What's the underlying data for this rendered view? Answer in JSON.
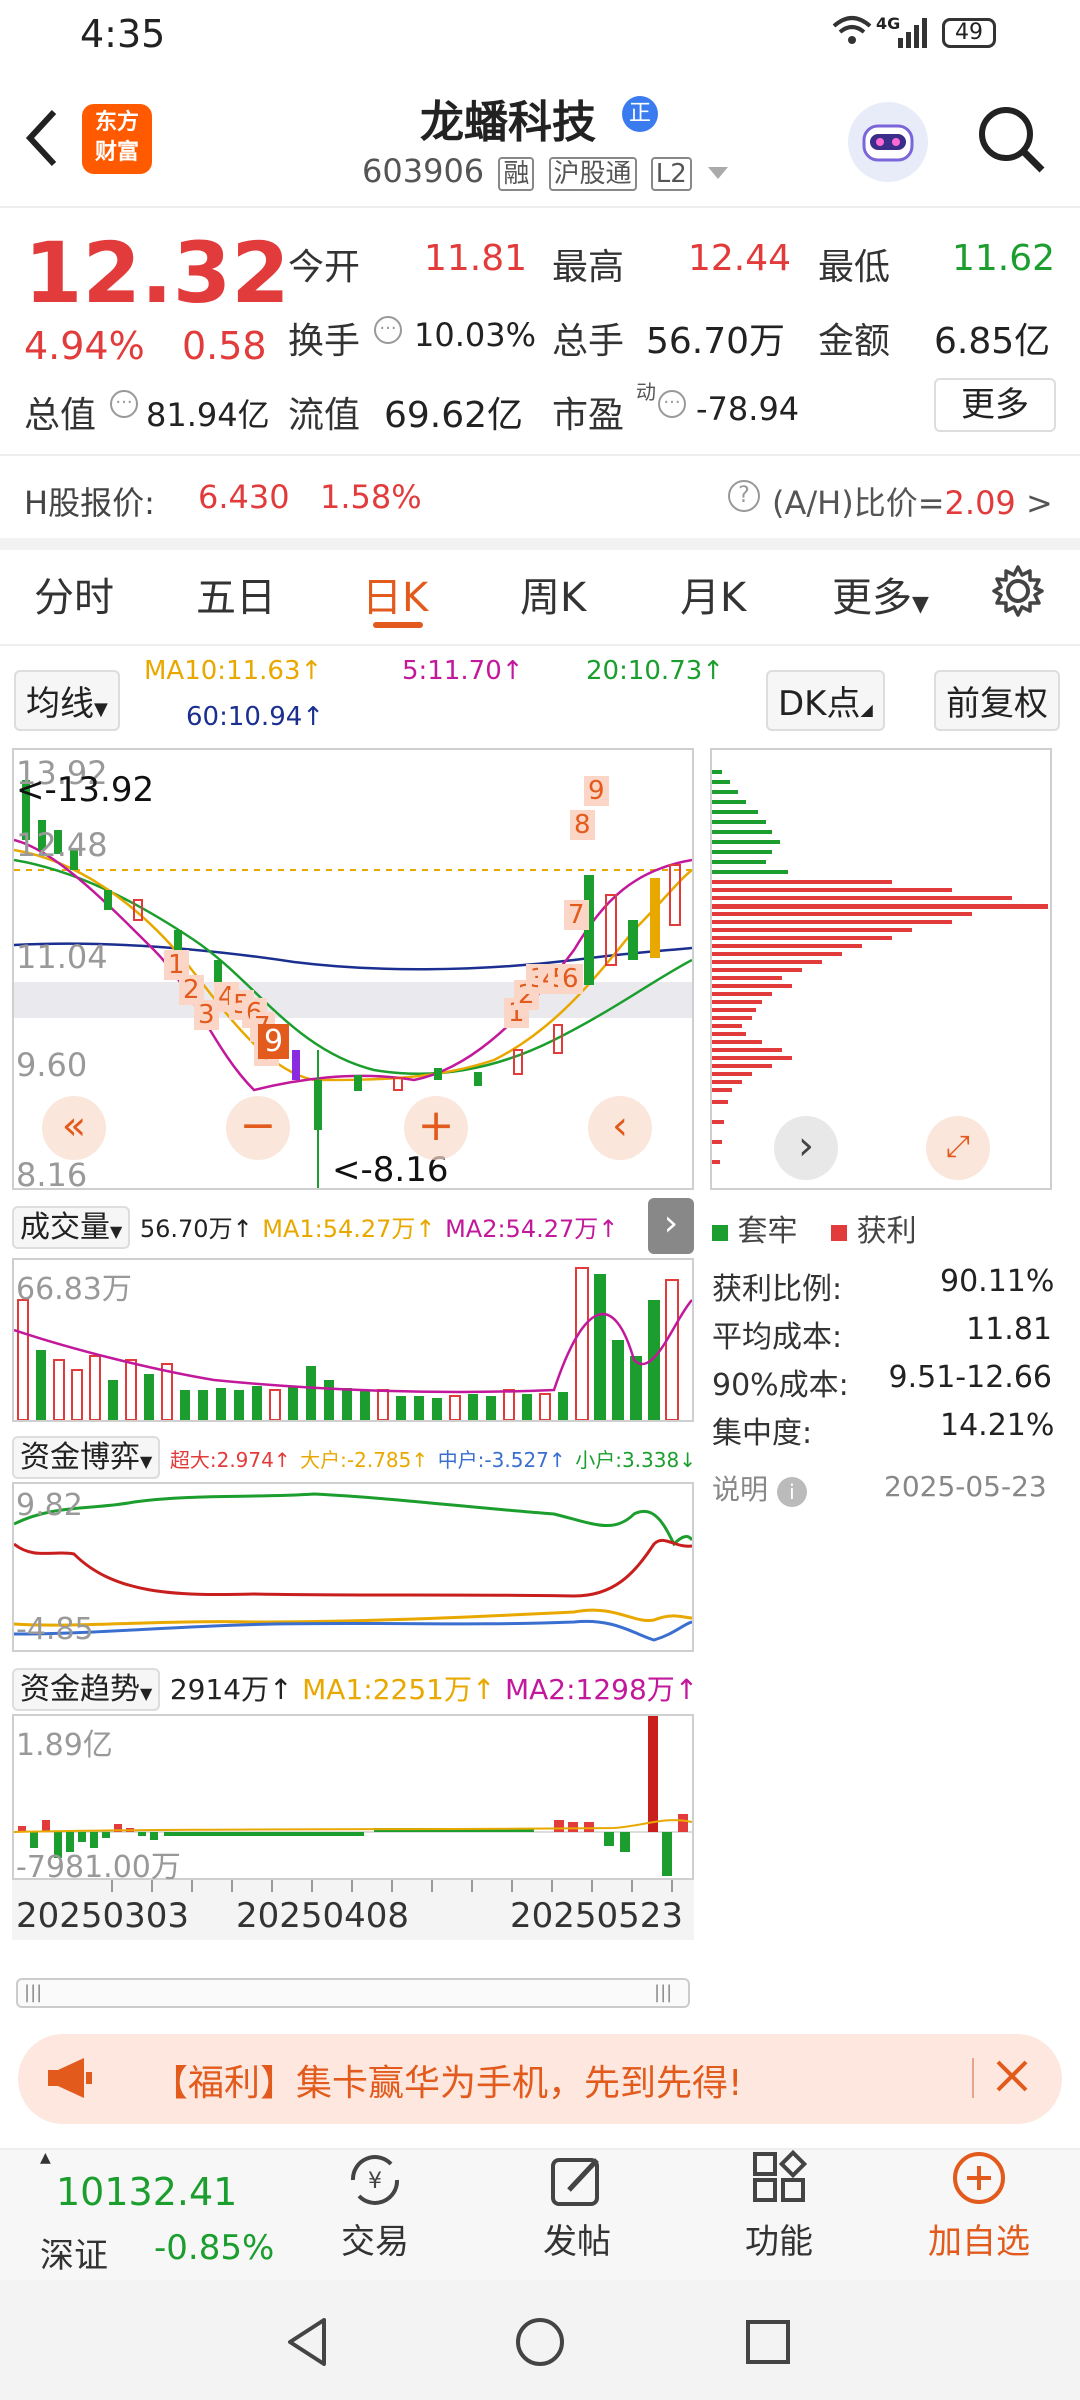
{
  "status_bar": {
    "time": "4:35",
    "network": "4G",
    "battery": "49"
  },
  "header": {
    "back_icon": "back-arrow-icon",
    "logo_line1": "东方",
    "logo_line2": "财富",
    "stock_name": "龙蟠科技",
    "stock_badge": "正",
    "stock_code": "603906",
    "tags": [
      "融",
      "沪股通",
      "L2"
    ],
    "search_icon": "search-icon"
  },
  "quote": {
    "price": "12.32",
    "change_pct": "4.94%",
    "change_amt": "0.58",
    "open_label": "今开",
    "open": "11.81",
    "high_label": "最高",
    "high": "12.44",
    "low_label": "最低",
    "low": "11.62",
    "turnover_label": "换手",
    "turnover": "10.03%",
    "volume_label": "总手",
    "volume": "56.70万",
    "amount_label": "金额",
    "amount": "6.85亿",
    "mktcap_label": "总值",
    "mktcap": "81.94亿",
    "float_label": "流值",
    "float": "69.62亿",
    "pe_label": "市盈",
    "pe_sup": "动",
    "pe": "-78.94",
    "more_label": "更多"
  },
  "hshare": {
    "label": "H股报价:",
    "price": "6.430",
    "pct": "1.58%",
    "ah_label": "(A/H)比价=",
    "ah_value": "2.09",
    "chevron": ">"
  },
  "tabs": [
    "分时",
    "五日",
    "日K",
    "周K",
    "月K",
    "更多"
  ],
  "active_tab": "日K",
  "ma": {
    "selector": "均线",
    "ma10": "MA10:11.63↑",
    "ma5": "5:11.70↑",
    "ma20": "20:10.73↑",
    "ma60": "60:10.94↑",
    "dk": "DK点",
    "adjust": "前复权"
  },
  "kline": {
    "y_labels": [
      "13.92",
      "12.48",
      "11.04",
      "9.60",
      "8.16"
    ],
    "max_label": "<-13.92",
    "min_label": "<-8.16",
    "signals": [
      "1",
      "2",
      "3",
      "4",
      "5",
      "6",
      "7",
      "8",
      "9",
      "1",
      "2",
      "3",
      "4",
      "5",
      "6",
      "7",
      "8",
      "9"
    ]
  },
  "volume": {
    "selector": "成交量",
    "value": "56.70万↑",
    "ma1": "MA1:54.27万↑",
    "ma2": "MA2:54.27万↑",
    "y_label": "66.83万"
  },
  "fund_game": {
    "selector": "资金博弈",
    "super": "超大:2.974↑",
    "big": "大户:-2.785↑",
    "mid": "中户:-3.527↑",
    "small": "小户:3.338↓",
    "y_top": "9.82",
    "y_bottom": "-4.85"
  },
  "fund_trend": {
    "selector": "资金趋势",
    "value": "2914万↑",
    "ma1": "MA1:2251万↑",
    "ma2": "MA2:1298万↑",
    "y_top": "1.89亿",
    "y_bottom": "-7981.00万"
  },
  "dates": [
    "20250303",
    "20250408",
    "20250523"
  ],
  "chip": {
    "legend_trap": "套牢",
    "legend_profit": "获利",
    "profit_ratio_label": "获利比例:",
    "profit_ratio": "90.11%",
    "avg_cost_label": "平均成本:",
    "avg_cost": "11.81",
    "cost90_label": "90%成本:",
    "cost90": "9.51-12.66",
    "concentration_label": "集中度:",
    "concentration": "14.21%",
    "note_label": "说明",
    "date": "2025-05-23"
  },
  "banner": {
    "text": "【福利】集卡赢华为手机，先到先得!"
  },
  "bottom_nav": {
    "index_value": "10132.41",
    "index_name": "深证",
    "index_pct": "-0.85%",
    "trade": "交易",
    "post": "发帖",
    "func": "功能",
    "add": "加自选"
  },
  "colors": {
    "red": "#e23b3b",
    "green": "#1b9e2e",
    "accent": "#e25a1c",
    "ma10": "#e8a800",
    "ma5": "#c2189b",
    "ma20": "#1b9e2e",
    "ma60": "#1a2f8f"
  }
}
